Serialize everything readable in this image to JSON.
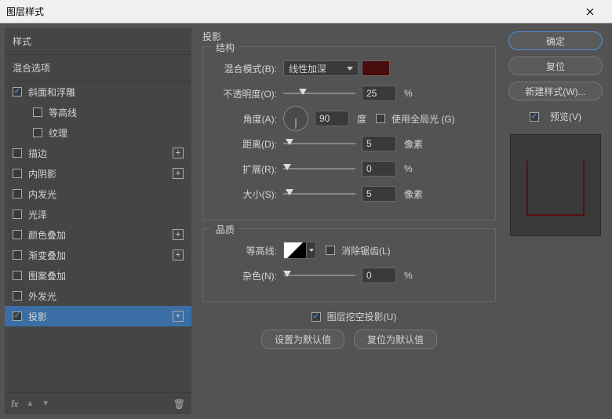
{
  "window": {
    "title": "图层样式"
  },
  "sidebar": {
    "header": "样式",
    "blend_options": "混合选项",
    "items": [
      {
        "label": "斜面和浮雕",
        "checked": true,
        "hasPlus": false
      },
      {
        "label": "等高线",
        "checked": false,
        "indent": true
      },
      {
        "label": "纹理",
        "checked": false,
        "indent": true
      },
      {
        "label": "描边",
        "checked": false,
        "hasPlus": true
      },
      {
        "label": "内阴影",
        "checked": false,
        "hasPlus": true
      },
      {
        "label": "内发光",
        "checked": false
      },
      {
        "label": "光泽",
        "checked": false
      },
      {
        "label": "颜色叠加",
        "checked": false,
        "hasPlus": true
      },
      {
        "label": "渐变叠加",
        "checked": false,
        "hasPlus": true
      },
      {
        "label": "图案叠加",
        "checked": false
      },
      {
        "label": "外发光",
        "checked": false
      },
      {
        "label": "投影",
        "checked": true,
        "hasPlus": true,
        "selected": true
      }
    ],
    "footer_fx": "fx"
  },
  "panel": {
    "title": "投影",
    "structure": {
      "legend": "结构",
      "blend_mode_label": "混合模式(B):",
      "blend_mode_value": "线性加深",
      "color": "#4a0d0d",
      "opacity_label": "不透明度(O):",
      "opacity_value": "25",
      "opacity_unit": "%",
      "angle_label": "角度(A):",
      "angle_value": "90",
      "angle_unit": "度",
      "global_light_label": "使用全局光 (G)",
      "global_light_checked": false,
      "distance_label": "距离(D):",
      "distance_value": "5",
      "distance_unit": "像素",
      "spread_label": "扩展(R):",
      "spread_value": "0",
      "spread_unit": "%",
      "size_label": "大小(S):",
      "size_value": "5",
      "size_unit": "像素"
    },
    "quality": {
      "legend": "品质",
      "contour_label": "等高线:",
      "antialias_label": "消除锯齿(L)",
      "antialias_checked": false,
      "noise_label": "杂色(N):",
      "noise_value": "0",
      "noise_unit": "%"
    },
    "knockout_label": "图层挖空投影(U)",
    "knockout_checked": true,
    "btn_default": "设置为默认值",
    "btn_reset": "复位为默认值"
  },
  "right": {
    "ok": "确定",
    "cancel": "复位",
    "new_style": "新建样式(W)...",
    "preview_label": "预览(V)",
    "preview_checked": true
  }
}
